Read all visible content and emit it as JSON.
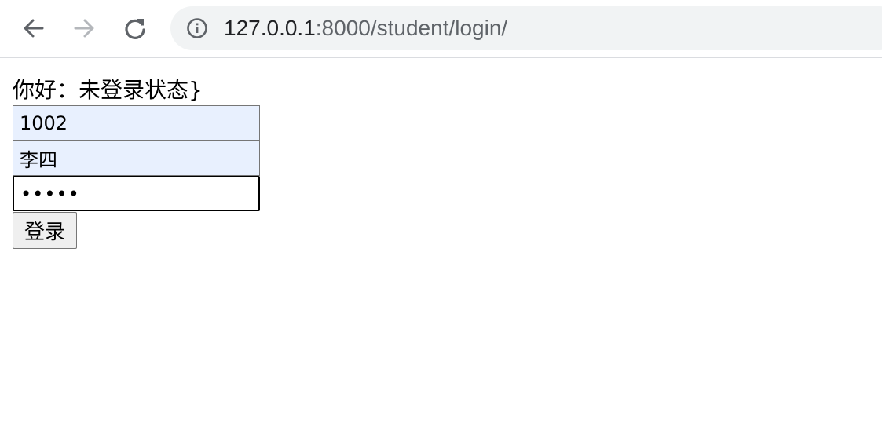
{
  "browser": {
    "url_host": "127.0.0.1",
    "url_path": ":8000/student/login/",
    "icons": {
      "back": "arrow-left-icon",
      "forward": "arrow-right-icon",
      "reload": "reload-icon",
      "site_info": "info-icon"
    },
    "forward_disabled": true
  },
  "page": {
    "greeting": "你好：未登录状态}",
    "form": {
      "student_id_value": "1002",
      "name_value": "李四",
      "password_value": "12345",
      "submit_label": "登录"
    }
  }
}
